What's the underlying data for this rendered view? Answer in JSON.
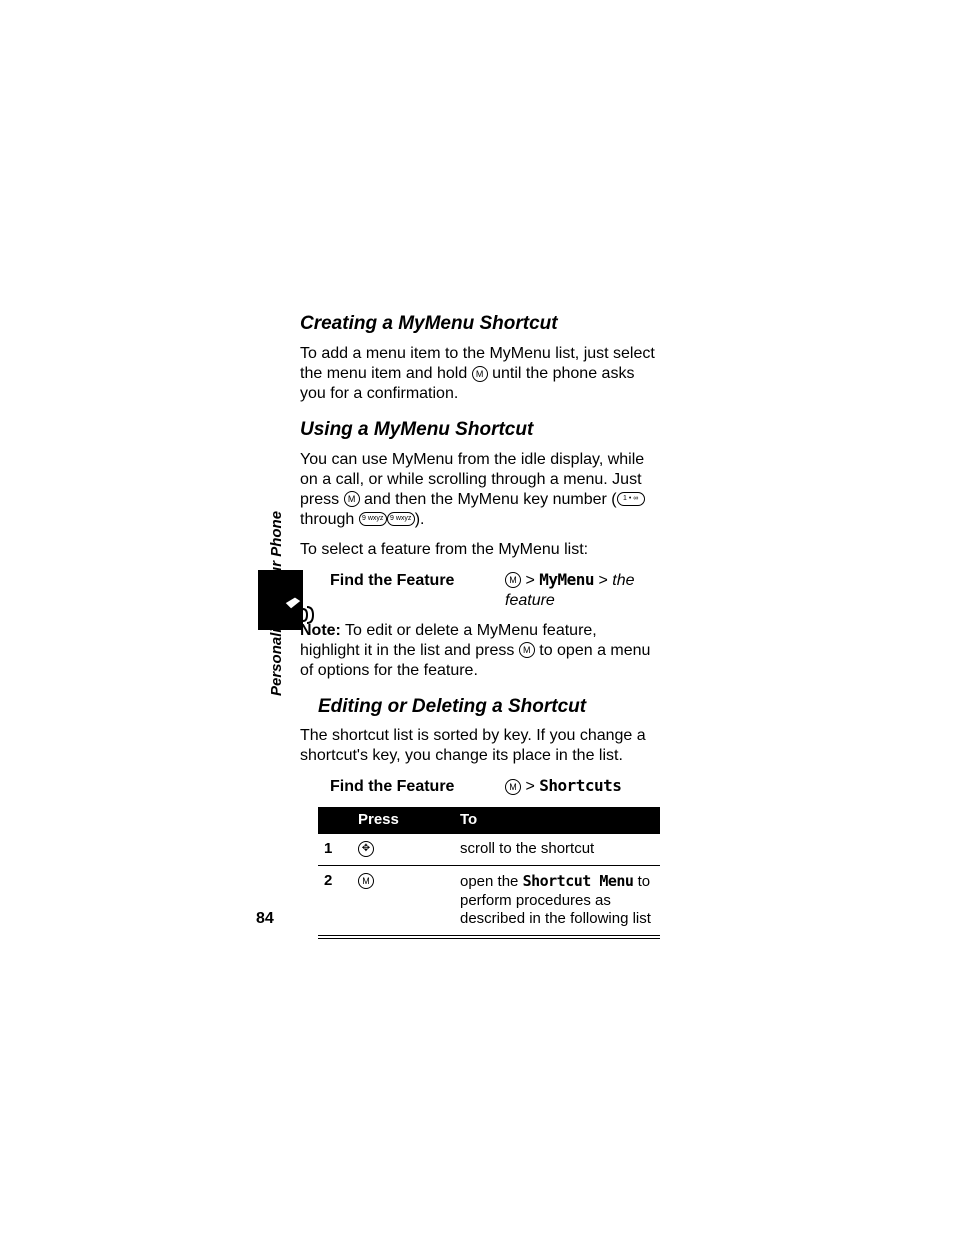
{
  "sidebar": {
    "caption": "Personalizing Your Phone"
  },
  "page_number": "84",
  "section1": {
    "heading": "Creating a MyMenu Shortcut",
    "body_before": "To add a menu item to the MyMenu list, just select the menu item and hold ",
    "body_after": " until the phone asks you for a confirmation."
  },
  "section2": {
    "heading": "Using a MyMenu Shortcut",
    "p1_a": "You can use MyMenu from the idle display, while on a call, or while scrolling through a menu. Just press ",
    "p1_b": " and then the MyMenu key number (",
    "p1_c": " through ",
    "p1_d": ").",
    "p2": "To select a feature from the MyMenu list:",
    "find_label": "Find the Feature",
    "find_path_menu": "MyMenu",
    "find_path_suffix": "the feature",
    "note_label": "Note:",
    "note_a": " To edit or delete a MyMenu feature, highlight it in the list and press ",
    "note_b": " to open a menu of options for the feature."
  },
  "section3": {
    "heading": "Editing or Deleting a Shortcut",
    "p1": "The shortcut list is sorted by key. If you change a shortcut's key, you change its place in the list.",
    "find_label": "Find the Feature",
    "find_path_menu": "Shortcuts",
    "table": {
      "head_press": "Press",
      "head_to": "To",
      "rows": [
        {
          "step": "1",
          "to": "scroll to the shortcut"
        },
        {
          "step": "2",
          "to_a": "open the ",
          "to_menu": "Shortcut Menu",
          "to_b": " to perform procedures as described in the following list"
        }
      ]
    }
  },
  "icons": {
    "menu_key": "M",
    "nav_key": "✥",
    "key1": "1 • ∞",
    "key9": "9 wxyz"
  }
}
